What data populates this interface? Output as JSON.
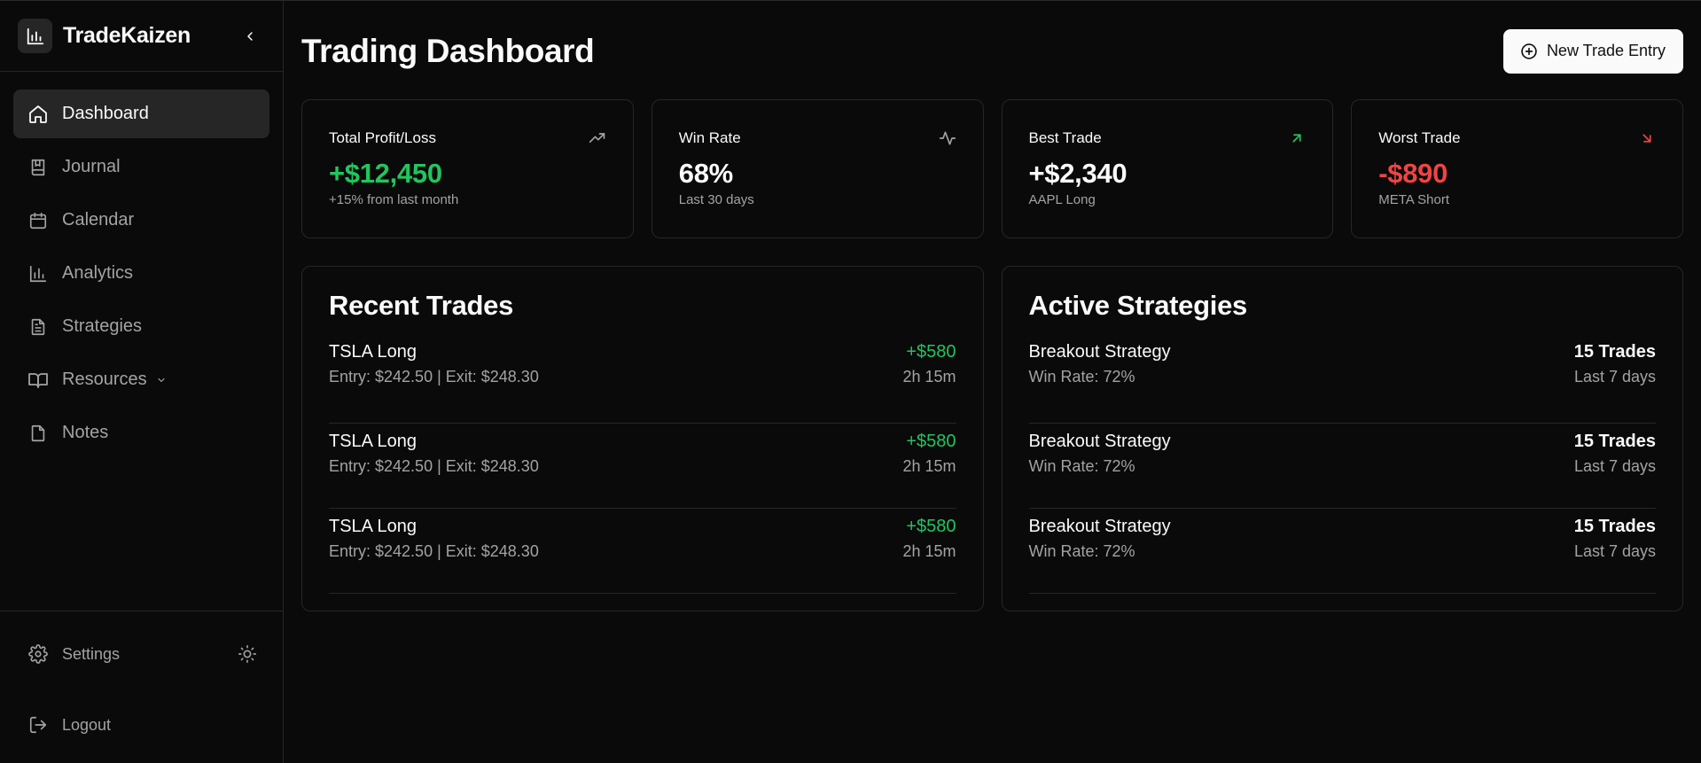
{
  "app": {
    "name": "TradeKaizen"
  },
  "sidebar": {
    "items": [
      {
        "label": "Dashboard",
        "icon": "home-icon",
        "active": true
      },
      {
        "label": "Journal",
        "icon": "book-icon"
      },
      {
        "label": "Calendar",
        "icon": "calendar-icon"
      },
      {
        "label": "Analytics",
        "icon": "bar-chart-icon"
      },
      {
        "label": "Strategies",
        "icon": "document-icon"
      },
      {
        "label": "Resources",
        "icon": "open-book-icon",
        "has_dropdown": true
      },
      {
        "label": "Notes",
        "icon": "file-icon"
      }
    ],
    "footer": {
      "settings_label": "Settings",
      "logout_label": "Logout"
    }
  },
  "header": {
    "title": "Trading Dashboard",
    "new_button_label": "New Trade Entry"
  },
  "stats": [
    {
      "title": "Total Profit/Loss",
      "value": "+$12,450",
      "sub": "+15% from last month",
      "icon": "trending-up-icon",
      "tone": "green"
    },
    {
      "title": "Win Rate",
      "value": "68%",
      "sub": "Last 30 days",
      "icon": "activity-icon",
      "tone": "white"
    },
    {
      "title": "Best Trade",
      "value": "+$2,340",
      "sub": "AAPL Long",
      "icon": "arrow-up-right-icon",
      "tone": "white"
    },
    {
      "title": "Worst Trade",
      "value": "-$890",
      "sub": "META Short",
      "icon": "arrow-down-right-icon",
      "tone": "red"
    }
  ],
  "recent_trades": {
    "title": "Recent Trades",
    "rows": [
      {
        "name": "TSLA Long",
        "detail": "Entry: $242.50 | Exit: $248.30",
        "pnl": "+$580",
        "duration": "2h 15m"
      },
      {
        "name": "TSLA Long",
        "detail": "Entry: $242.50 | Exit: $248.30",
        "pnl": "+$580",
        "duration": "2h 15m"
      },
      {
        "name": "TSLA Long",
        "detail": "Entry: $242.50 | Exit: $248.30",
        "pnl": "+$580",
        "duration": "2h 15m"
      }
    ]
  },
  "active_strategies": {
    "title": "Active Strategies",
    "rows": [
      {
        "name": "Breakout Strategy",
        "detail": "Win Rate: 72%",
        "trades": "15 Trades",
        "period": "Last 7 days"
      },
      {
        "name": "Breakout Strategy",
        "detail": "Win Rate: 72%",
        "trades": "15 Trades",
        "period": "Last 7 days"
      },
      {
        "name": "Breakout Strategy",
        "detail": "Win Rate: 72%",
        "trades": "15 Trades",
        "period": "Last 7 days"
      }
    ]
  },
  "colors": {
    "background": "#0a0a0a",
    "border": "#262626",
    "positive": "#22c55e",
    "negative": "#ef4444",
    "muted": "#a3a3a3"
  }
}
